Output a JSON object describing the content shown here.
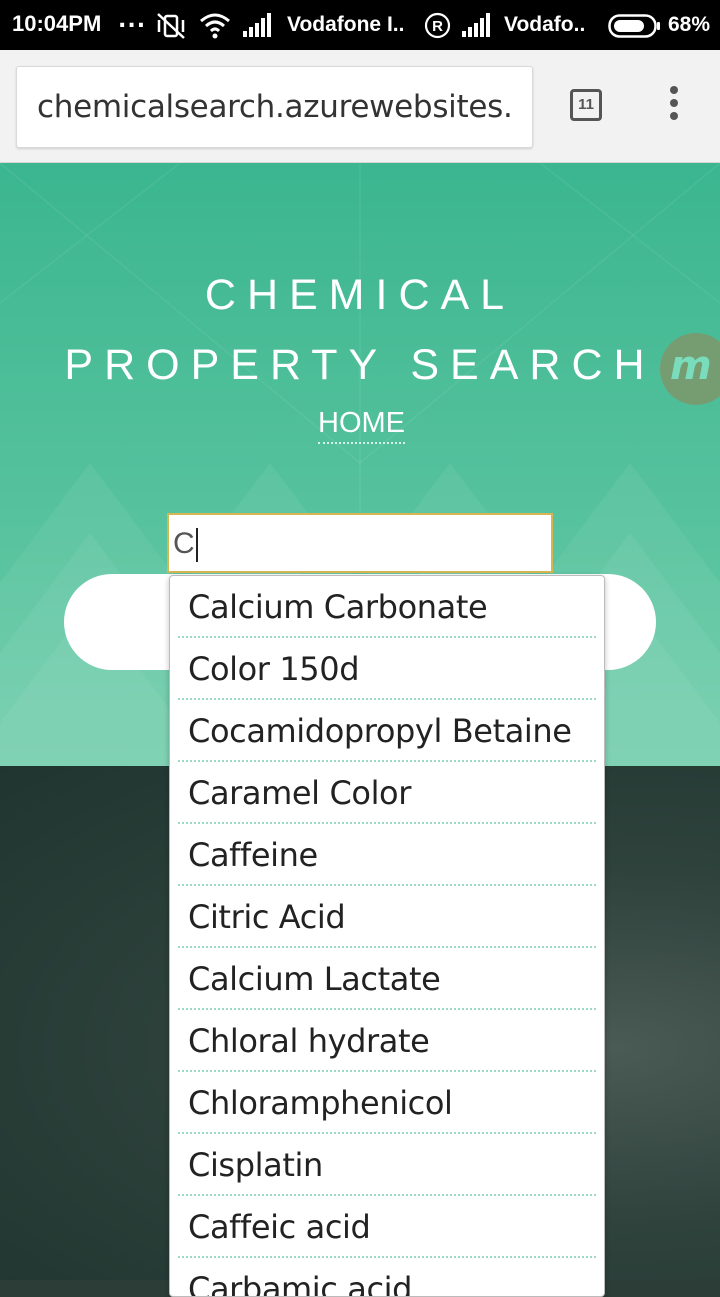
{
  "status_bar": {
    "time": "10:04PM",
    "overflow": "...",
    "carrier1": "Vodafone I..",
    "carrier2": "Vodafo..",
    "battery": "68%"
  },
  "browser": {
    "url": "chemicalsearch.azurewebsites.",
    "tab_count": "11"
  },
  "hero": {
    "title_line1": "CHEMICAL",
    "title_line2": "PROPERTY SEARCH",
    "home_link": "HOME",
    "badge_letter": "m"
  },
  "search": {
    "value": "C"
  },
  "suggestions": [
    "Calcium Carbonate",
    "Color 150d",
    "Cocamidopropyl Betaine",
    "Caramel Color",
    "Caffeine",
    "Citric Acid",
    "Calcium Lactate",
    "Chloral hydrate",
    "Chloramphenicol",
    "Cisplatin",
    "Caffeic acid",
    "Carbamic acid"
  ],
  "colors": {
    "hero_green": "#3bb68f",
    "input_border": "#d6b654",
    "divider": "#9fd9c2"
  }
}
